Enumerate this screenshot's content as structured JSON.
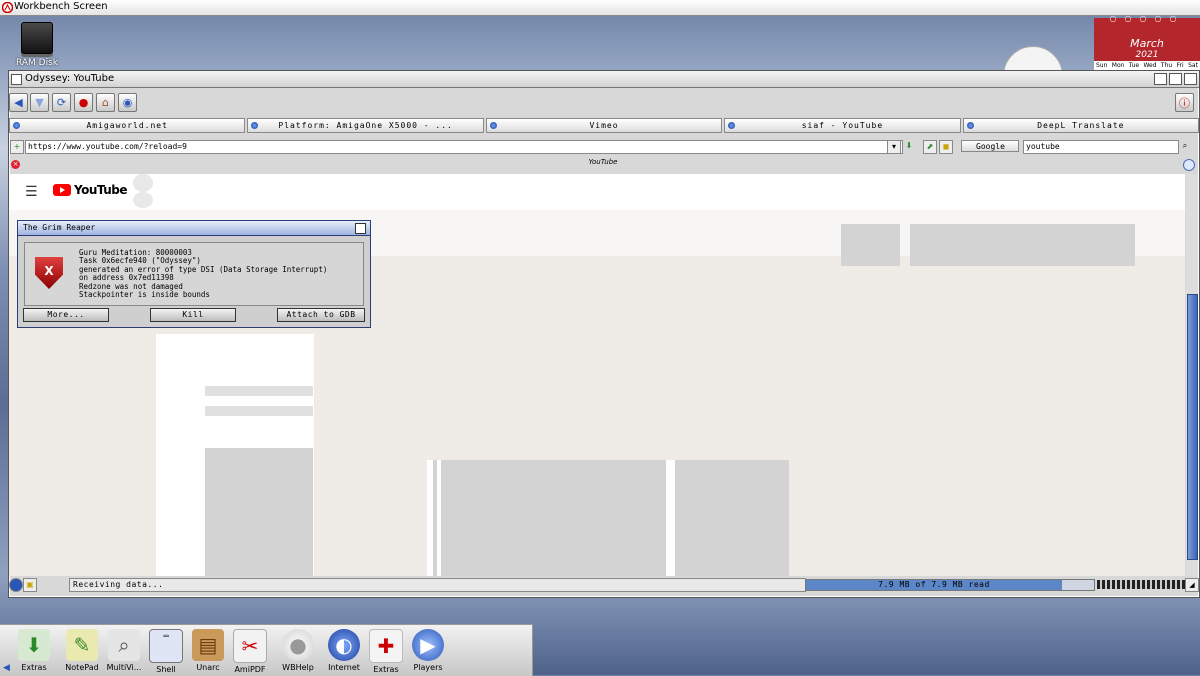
{
  "screen": {
    "title": "Workbench Screen"
  },
  "desktop": {
    "ramdisk_label": "RAM Disk"
  },
  "calendar": {
    "month": "March",
    "year": "2021",
    "days": [
      "Sun",
      "Mon",
      "Tue",
      "Wed",
      "Thu",
      "Fri",
      "Sat"
    ]
  },
  "window": {
    "title": "Odyssey: YouTube"
  },
  "bookmarks": [
    "Amigaworld.net",
    "Platform: AmigaOne X5000 - ...",
    "Vimeo",
    "siaf - YouTube",
    "DeepL Translate"
  ],
  "address": {
    "url": "https://www.youtube.com/?reload=9",
    "engine": "Google",
    "search": "youtube"
  },
  "tab": {
    "title": "YouTube"
  },
  "youtube": {
    "logo_text": "YouTube"
  },
  "status": {
    "text": "Receiving data...",
    "progress_text": "7.9 MB of 7.9 MB read",
    "progress": 1.0
  },
  "reaper": {
    "title": "The Grim Reaper",
    "lines": [
      "Guru Meditation: 80000003",
      "Task 0x6ecfe940 (\"Odyssey\")",
      "generated an error of type DSI (Data Storage Interrupt)",
      "on address 0x7ed11398",
      "Redzone was not damaged",
      "Stackpointer is inside bounds"
    ],
    "buttons": {
      "more": "More...",
      "kill": "Kill",
      "gdb": "Attach to GDB"
    }
  },
  "dock": [
    {
      "label": "Extras",
      "icon": "download-icon"
    },
    {
      "label": "NotePad",
      "icon": "notepad-icon"
    },
    {
      "label": "MultiVi...",
      "icon": "magnifier-icon"
    },
    {
      "label": "Shell",
      "icon": "shell-icon"
    },
    {
      "label": "Unarc",
      "icon": "archive-icon"
    },
    {
      "label": "AmiPDF",
      "icon": "pdf-icon"
    },
    {
      "label": "WBHelp",
      "icon": "lightbulb-icon"
    },
    {
      "label": "Internet",
      "icon": "globe-icon"
    },
    {
      "label": "Extras",
      "icon": "package-icon"
    },
    {
      "label": "Players",
      "icon": "play-icon"
    }
  ]
}
